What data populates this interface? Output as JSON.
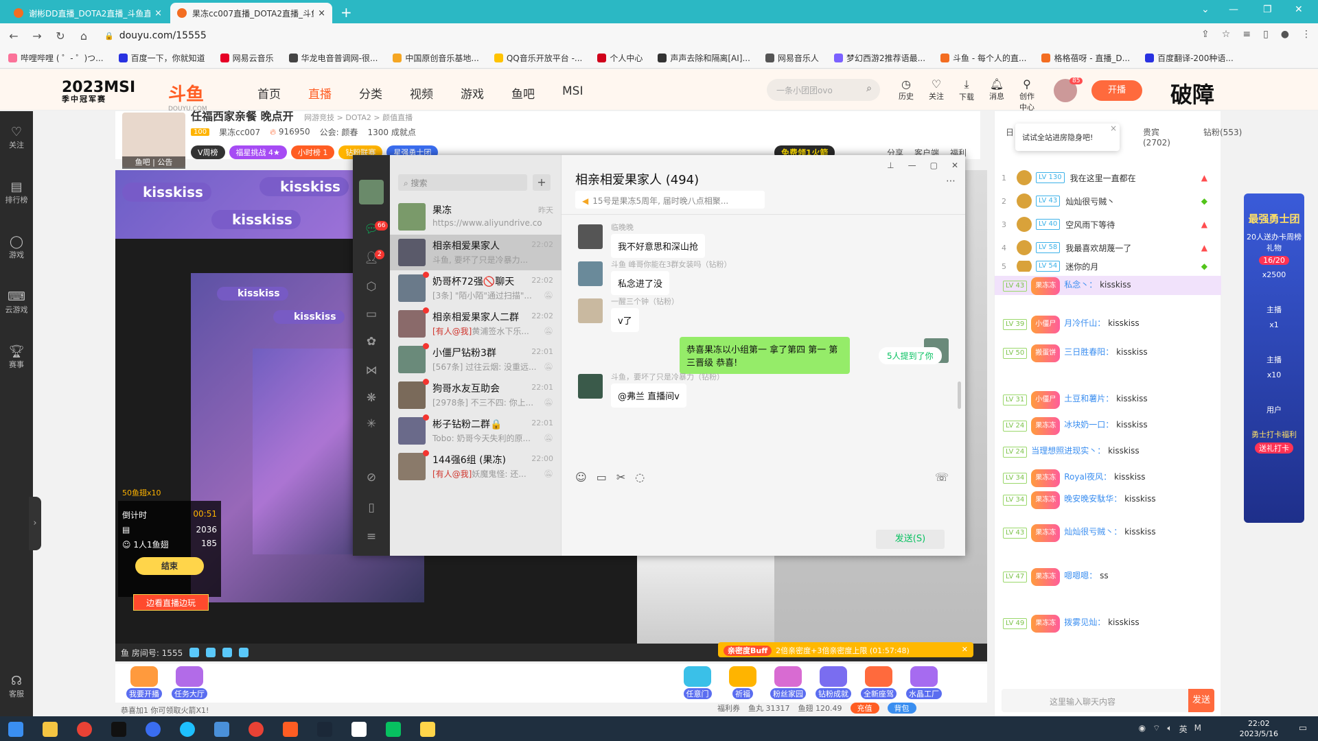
{
  "browser": {
    "tabs": [
      {
        "title": "谢彬DD直播_DOTA2直播_斗鱼直"
      },
      {
        "title": "果冻cc007直播_DOTA2直播_斗鱼"
      }
    ],
    "url": "douyu.com/15555",
    "bookmarks": [
      "哔哩哔哩 ( ゜- ゜)つ...",
      "百度一下，你就知道",
      "网易云音乐",
      "华龙电音普调网-很...",
      "中国原创音乐基地...",
      "QQ音乐开放平台 -...",
      "个人中心",
      "声声去除和隔离[AI]...",
      "网易音乐人",
      "梦幻西游2推荐语最...",
      "斗鱼 - 每个人的直...",
      "格格蓓呀 - 直播_D...",
      "百度翻译-200种语..."
    ]
  },
  "header": {
    "msi_title": "2023MSI",
    "msi_sub": "季中冠军赛",
    "logo": "斗鱼",
    "logo_sub": "DOUYU.COM",
    "nav": [
      "首页",
      "直播",
      "分类",
      "视频",
      "游戏",
      "鱼吧",
      "MSI"
    ],
    "search_placeholder": "一条小团团ovo",
    "icons": [
      "历史",
      "关注",
      "下载",
      "消息",
      "创作中心"
    ],
    "avatar_badge": "85",
    "kaibo": "开播",
    "pozhang": "破障"
  },
  "sidebar": {
    "items": [
      "关注",
      "排行榜",
      "游戏",
      "云游戏",
      "赛事",
      "客服"
    ]
  },
  "room": {
    "title": "任福西家亲餐 晚点开",
    "category": "网游竞技 > DOTA2 > 颜值直播",
    "level": "100",
    "name": "果冻cc007",
    "hot": "916950",
    "guild": "公会: 颜春",
    "achievements": "1300 成就点",
    "ava_foot": "鱼吧 | 公告",
    "tags": [
      "V周榜",
      "福星挑战 4★",
      "小时榜 1",
      "钻粉联赛",
      "星强勇士团"
    ],
    "free_btn": "免费领1火箭",
    "right": [
      "分享",
      "客户端",
      "福利"
    ]
  },
  "video": {
    "kiss_texts": [
      "kisskiss",
      "kisskiss",
      "kisskiss",
      "kisskiss",
      "kisskiss"
    ],
    "fish_label": "50鱼翅x10",
    "timer_label": "倒计时",
    "timer_value": "00:51",
    "count1": "2036",
    "count2": "185",
    "people": "1人1鱼翅",
    "end_btn": "结束",
    "edge_btn": "边看直播边玩",
    "room_no": "鱼 房间号: 1555",
    "buff_tag": "亲密度Buff",
    "buff_text": "2倍亲密度+3倍亲密度上限 (01:57:48)"
  },
  "wechat": {
    "search": "搜索",
    "chats": [
      {
        "name": "果冻",
        "time": "昨天",
        "preview": "https://www.aliyundrive.com/..."
      },
      {
        "name": "相亲相爱果家人",
        "time": "22:02",
        "preview": "斗鱼, 要坏了只是冷暴力..."
      },
      {
        "name": "奶哥杯72强🚫聊天",
        "time": "22:02",
        "preview": "[3条] \"陌小陌\"通过扫描\"..."
      },
      {
        "name": "相亲相爱果家人二群",
        "time": "22:02",
        "mention": "[有人@我]",
        "preview": "黄浦签水下乐..."
      },
      {
        "name": "小僵尸钻粉3群",
        "time": "22:01",
        "preview": "[567条] 过往云烟: 没重远..."
      },
      {
        "name": "狗哥水友互助会",
        "time": "22:01",
        "preview": "[2978条] 不三不四: 你上..."
      },
      {
        "name": "彬子钻粉二群🔒",
        "time": "22:01",
        "preview": "Tobo: 奶哥今天失利的原..."
      },
      {
        "name": "144强6组 (果冻)",
        "time": "22:00",
        "mention": "[有人@我]",
        "preview": "妖魔鬼怪: 还..."
      }
    ],
    "nav_badges": [
      "66",
      "2"
    ],
    "title": "相亲相爱果家人 (494)",
    "notice": "15号是果冻5周年, 届时晚八点相聚...",
    "messages": [
      {
        "sender": "临晚晚",
        "text": "我不好意思和深山抢",
        "me": false
      },
      {
        "sender": "斗鱼 峰哥你能在3群女装吗（钻粉）",
        "text": "私念进了没",
        "me": false
      },
      {
        "sender": "一醒三个钟（钻粉）",
        "text": "v了",
        "me": false
      },
      {
        "sender": "",
        "text": "恭喜果冻以小组第一 拿了第四 第一 第三晋级 恭喜!",
        "me": true
      },
      {
        "sender": "斗鱼，要坏了只是冷暴力（钻粉）",
        "text": "@弗兰 直播间v",
        "me": false
      }
    ],
    "mention_pill": "5人提到了你",
    "send": "发送(S)"
  },
  "right_panel": {
    "tip": "试试全站进房隐身吧!",
    "tabs": [
      "日",
      "周",
      "贵宾(2702)",
      "钻粉(553)"
    ],
    "ranks": [
      {
        "n": "1",
        "lv": "LV 130",
        "text": "我在这里一直都在",
        "up": true
      },
      {
        "n": "2",
        "lv": "LV 43",
        "text": "灿灿很亏贼丶",
        "up": false
      },
      {
        "n": "3",
        "lv": "LV 40",
        "text": "空风雨下等待",
        "up": true
      },
      {
        "n": "4",
        "lv": "LV 58",
        "text": "我最喜欢胡蔑一了",
        "up": true
      },
      {
        "n": "5",
        "lv": "LV 54",
        "text": "迷你的月",
        "up": false
      }
    ],
    "danmu": [
      {
        "lv": "LV 43",
        "fan": "果冻冻",
        "nick": "私念丶：",
        "text": "kisskiss",
        "hl": true
      },
      {
        "lv": "LV 39",
        "fan": "小僵尸",
        "nick": "月冷仟山：",
        "text": "kisskiss",
        "hl": false
      },
      {
        "lv": "LV 50",
        "fan": "搬蛋饼",
        "nick": "三日胜春阳：",
        "text": "kisskiss",
        "hl": false
      },
      {
        "lv": "LV 31",
        "fan": "小僵尸",
        "nick": "土豆和薯片：",
        "text": "kisskiss",
        "hl": false
      },
      {
        "lv": "LV 24",
        "fan": "果冻冻",
        "nick": "冰块奶一口：",
        "text": "kisskiss",
        "hl": false
      },
      {
        "lv": "LV 24",
        "fan": "",
        "nick": "当理想照进现实丶：",
        "text": "kisskiss",
        "hl": false
      },
      {
        "lv": "LV 34",
        "fan": "果冻冻",
        "nick": "Royal夜风：",
        "text": "kisskiss",
        "hl": false
      },
      {
        "lv": "LV 34",
        "fan": "果冻冻",
        "nick": "晚安晚安駄华：",
        "text": "kisskiss",
        "hl": false
      },
      {
        "lv": "LV 43",
        "fan": "果冻冻",
        "nick": "灿灿很亏贼丶：",
        "text": "kisskiss",
        "hl": false
      },
      {
        "lv": "LV 47",
        "fan": "果冻冻",
        "nick": "嗯嗯嗯：",
        "text": "ss",
        "hl": false
      },
      {
        "lv": "LV 49",
        "fan": "果冻冻",
        "nick": "拨雾见灿：",
        "text": "kisskiss",
        "hl": false
      }
    ],
    "input_placeholder": "这里输入聊天内容",
    "send": "发送"
  },
  "promo": {
    "title": "最强勇士团",
    "l1": "20人送办卡周榜礼物",
    "progress": "16/20",
    "x1": "x2500",
    "x2": "x1",
    "x3": "x10",
    "roles": [
      "主播",
      "主播",
      "用户"
    ],
    "bottom": "勇士打卡福利",
    "btn": "送礼打卡"
  },
  "giftbar": {
    "left": [
      "我要开播",
      "任务大厅"
    ],
    "right": [
      "任意门",
      "祈福",
      "粉丝家园",
      "钻粉成就",
      "全新座驾",
      "水晶工厂"
    ],
    "bottom_left": "恭喜加1 你可领取火箭X1!",
    "fuli": "福利券",
    "fish_balls": "鱼丸 31317",
    "fish_fins": "鱼翅 120.49",
    "chong": "充值",
    "beibao": "背包"
  },
  "taskbar": {
    "time": "22:02",
    "date": "2023/5/16",
    "lang": "英"
  },
  "colors": {
    "tabbar": "#2bb8c4",
    "douyu_orange": "#ff5d23",
    "wechat_green": "#07c160",
    "bubble_me": "#95ec69"
  }
}
